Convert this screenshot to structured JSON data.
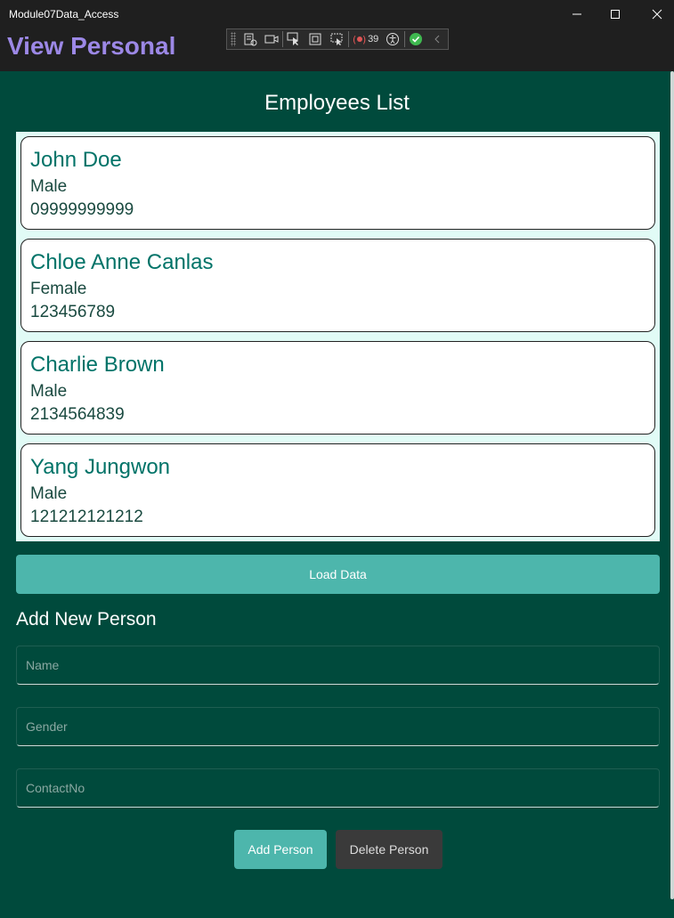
{
  "window": {
    "title": "Module07Data_Access"
  },
  "page": {
    "title": "View Personal"
  },
  "debug_toolbar": {
    "binding_failures_count": "39"
  },
  "employees": {
    "heading": "Employees List",
    "items": [
      {
        "name": "John Doe",
        "gender": "Male",
        "contact": "09999999999"
      },
      {
        "name": "Chloe Anne Canlas",
        "gender": "Female",
        "contact": "123456789"
      },
      {
        "name": "Charlie Brown",
        "gender": "Male",
        "contact": "2134564839"
      },
      {
        "name": "Yang Jungwon",
        "gender": "Male",
        "contact": "121212121212"
      }
    ]
  },
  "load_button": {
    "label": "Load Data"
  },
  "form": {
    "heading": "Add New Person",
    "name_placeholder": "Name",
    "gender_placeholder": "Gender",
    "contact_placeholder": "ContactNo",
    "add_label": "Add Person",
    "delete_label": "Delete Person"
  },
  "colors": {
    "background": "#004a3c",
    "accent": "#4db6ac",
    "title_purple": "#9c88e6",
    "name_teal": "#007368"
  }
}
